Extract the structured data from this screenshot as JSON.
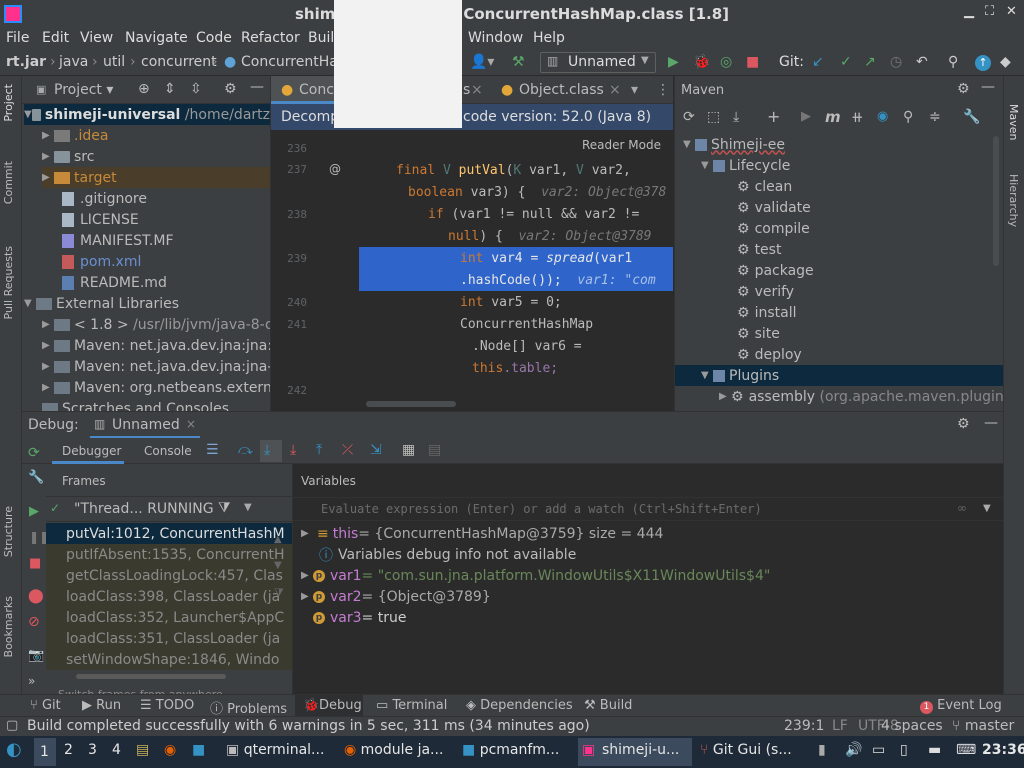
{
  "window": {
    "title_prefix": "shim",
    "title_suffix": "ConcurrentHashMap.class [1.8]"
  },
  "menu": [
    "File",
    "Edit",
    "View",
    "Navigate",
    "Code",
    "Refactor",
    "Buil",
    "Window",
    "Help"
  ],
  "breadcrumb": [
    "rt.jar",
    "java",
    "util",
    "concurrent",
    "ConcurrentHas"
  ],
  "toolbar": {
    "run_config": "Unnamed",
    "git_label": "Git:"
  },
  "left_stripe": [
    "Project",
    "Commit",
    "Pull Requests",
    "Structure",
    "Bookmarks"
  ],
  "right_stripe": [
    "Maven",
    "Hierarchy"
  ],
  "project": {
    "header": "Project",
    "root_name": "shimeji-universal",
    "root_path": "/home/dartz",
    "items": [
      {
        "label": ".idea"
      },
      {
        "label": "src"
      },
      {
        "label": "target"
      },
      {
        "label": ".gitignore"
      },
      {
        "label": "LICENSE"
      },
      {
        "label": "MANIFEST.MF"
      },
      {
        "label": "pom.xml"
      },
      {
        "label": "README.md"
      }
    ],
    "external": "External Libraries",
    "libs": [
      {
        "label": "< 1.8 >",
        "path": "/usr/lib/jvm/java-8-o"
      },
      {
        "label": "Maven: net.java.dev.jna:jna:5"
      },
      {
        "label": "Maven: net.java.dev.jna:jna-p"
      },
      {
        "label": "Maven: org.netbeans.externa"
      }
    ],
    "scratches": "Scratches and Consoles"
  },
  "editor": {
    "tabs": [
      "Concu",
      "s",
      "Object.class"
    ],
    "decompiled": "Decomp",
    "bytecode": "code version: 52.0 (Java 8)",
    "reader_mode": "Reader Mode",
    "lines": {
      "l236": "236",
      "l237": "237",
      "l238": "238",
      "l239": "239",
      "l240": "240",
      "l241": "241",
      "l242": "242",
      "annotation": "@",
      "c237a_kw": "final",
      "c237a_gen": "V",
      "c237a_fn": "putVal",
      "c237a_open": "(",
      "c237a_k": "K",
      "c237a_rest": " var1, ",
      "c237a_v": "V",
      "c237a_rest2": " var2,",
      "c237b": "boolean var3) {",
      "c237b_hint": "var2: Object@378",
      "c238a_kw": "if",
      "c238a": " (var1 != null && var2 !=",
      "c238b": "null) {",
      "c238b_hint": "var2: Object@3789",
      "c239a_kw": "int",
      "c239a": " var4 = ",
      "c239a_fn": "spread",
      "c239a_rest": "(var1",
      "c239b": ".hashCode());",
      "c239b_hint": "var1: \"com",
      "c240_kw": "int",
      "c240": " var5 = 0;",
      "c241a": "ConcurrentHashMap",
      "c241b": ".Node[] var6 =",
      "c241c_kw": "this",
      "c241c": ".table;"
    }
  },
  "maven": {
    "header": "Maven",
    "project": "Shimeji-ee",
    "lifecycle": "Lifecycle",
    "goals": [
      "clean",
      "validate",
      "compile",
      "test",
      "package",
      "verify",
      "install",
      "site",
      "deploy"
    ],
    "plugins": "Plugins",
    "assembly": "assembly",
    "assembly_detail": "(org.apache.maven.plugins:"
  },
  "debug": {
    "label": "Debug:",
    "session": "Unnamed",
    "tab_debugger": "Debugger",
    "tab_console": "Console",
    "frames_header": "Frames",
    "thread": "\"Thread... RUNNING",
    "frames": [
      "putVal:1012, ConcurrentHashM",
      "putIfAbsent:1535, ConcurrentH",
      "getClassLoadingLock:457, Clas",
      "loadClass:398, ClassLoader (ja",
      "loadClass:352, Launcher$AppC",
      "loadClass:351, ClassLoader (ja",
      "setWindowShape:1846, Windo"
    ],
    "switch_frames": "Switch frames from anywhere ...",
    "variables_header": "Variables",
    "eval_placeholder": "Evaluate expression (Enter) or add a watch (Ctrl+Shift+Enter)",
    "vars": [
      {
        "name": "this",
        "value": " = {ConcurrentHashMap@3759}  size = 444"
      },
      {
        "name": "",
        "value": "Variables debug info not available"
      },
      {
        "name": "var1",
        "value": " = \"com.sun.jna.platform.WindowUtils$X11WindowUtils$4\""
      },
      {
        "name": "var2",
        "value": " = {Object@3789}"
      },
      {
        "name": "var3",
        "value": " = true"
      }
    ]
  },
  "bottom_tabs": [
    "Git",
    "Run",
    "TODO",
    "Problems",
    "Debug",
    "Terminal",
    "Dependencies",
    "Build"
  ],
  "event_log": {
    "count": "1",
    "label": "Event Log"
  },
  "status": {
    "message": "Build completed successfully with 6 warnings in 5 sec, 311 ms (34 minutes ago)",
    "position": "239:1",
    "line_sep": "LF",
    "encoding": "UTF-8",
    "indent": "4 spaces",
    "branch": "master"
  },
  "taskbar": {
    "workspaces": [
      "1",
      "2",
      "3",
      "4"
    ],
    "apps": [
      "qterminal...",
      "module ja...",
      "pcmanfm...",
      "shimeji-u...",
      "Git Gui (s..."
    ],
    "clock": "23:36"
  },
  "colors": {
    "accent_blue": "#2f65ca",
    "selection": "#2f65ca",
    "green_run": "#59a869",
    "red_stop": "#db5860"
  }
}
